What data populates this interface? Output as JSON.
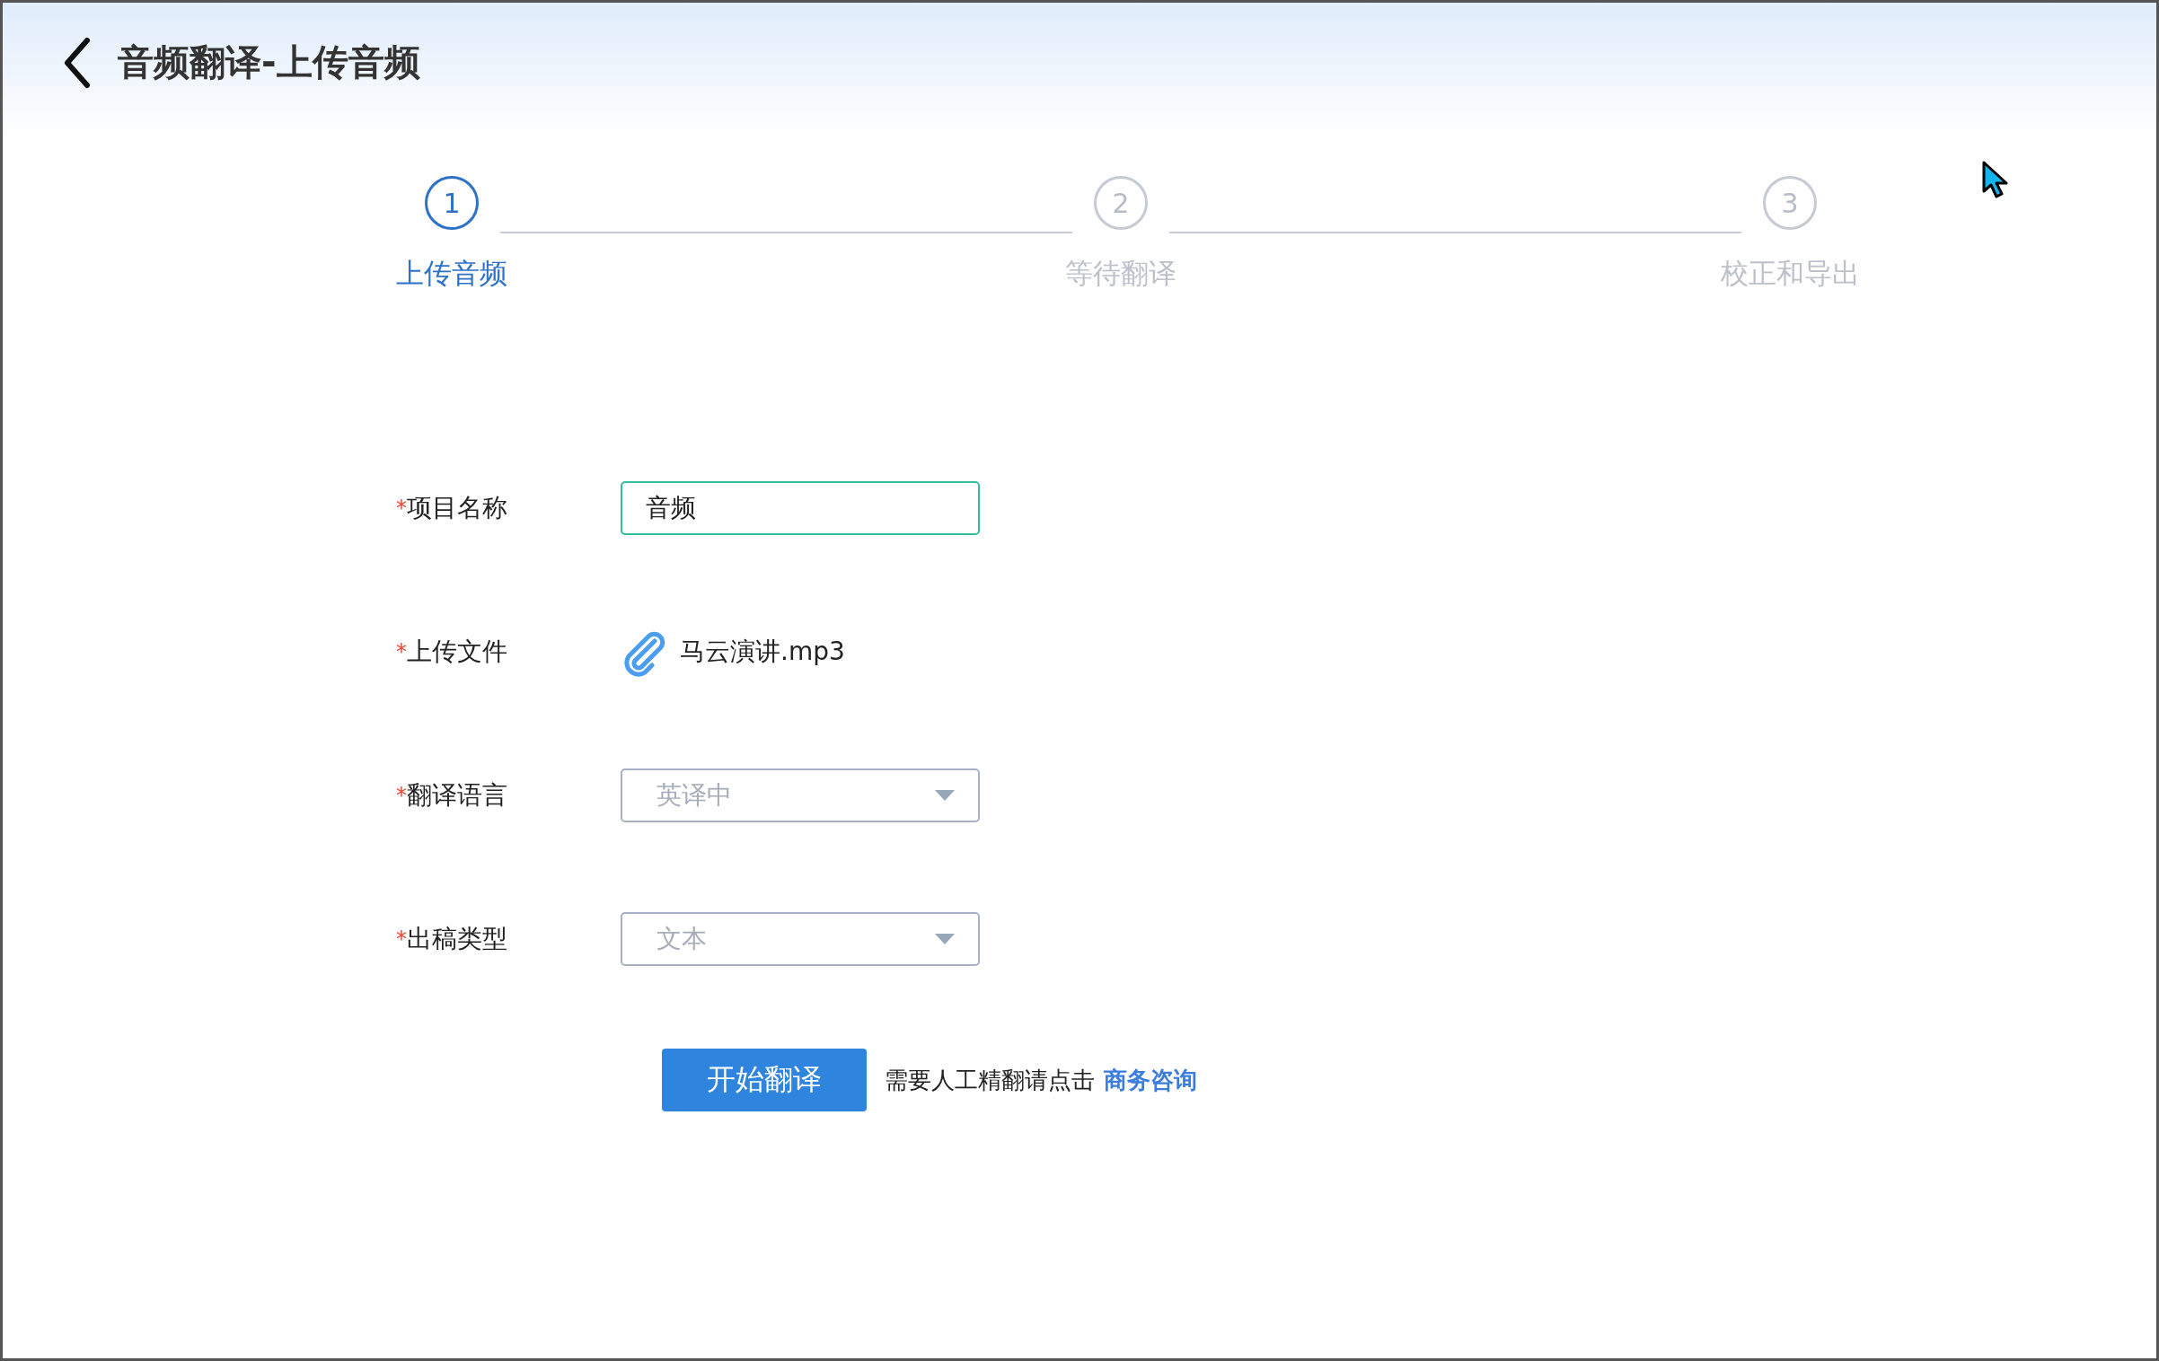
{
  "header": {
    "title": "音频翻译-上传音频"
  },
  "steps": [
    {
      "number": "1",
      "label": "上传音频",
      "selected": true
    },
    {
      "number": "2",
      "label": "等待翻译",
      "selected": false
    },
    {
      "number": "3",
      "label": "校正和导出",
      "selected": false
    }
  ],
  "form": {
    "fields": [
      {
        "kind": "input",
        "required_mark": "*",
        "label": "项目名称",
        "value": "音频",
        "focused": true
      },
      {
        "kind": "file",
        "required_mark": "*",
        "label": "上传文件",
        "file_name": "马云演讲.mp3"
      },
      {
        "kind": "select",
        "required_mark": "*",
        "label": "翻译语言",
        "value": "英译中",
        "disabled": true
      },
      {
        "kind": "select",
        "required_mark": "*",
        "label": "出稿类型",
        "value": "文本",
        "disabled": true
      }
    ],
    "submit_button": "开始翻译",
    "note": "需要人工精翻请点击",
    "link": "商务咨询"
  }
}
